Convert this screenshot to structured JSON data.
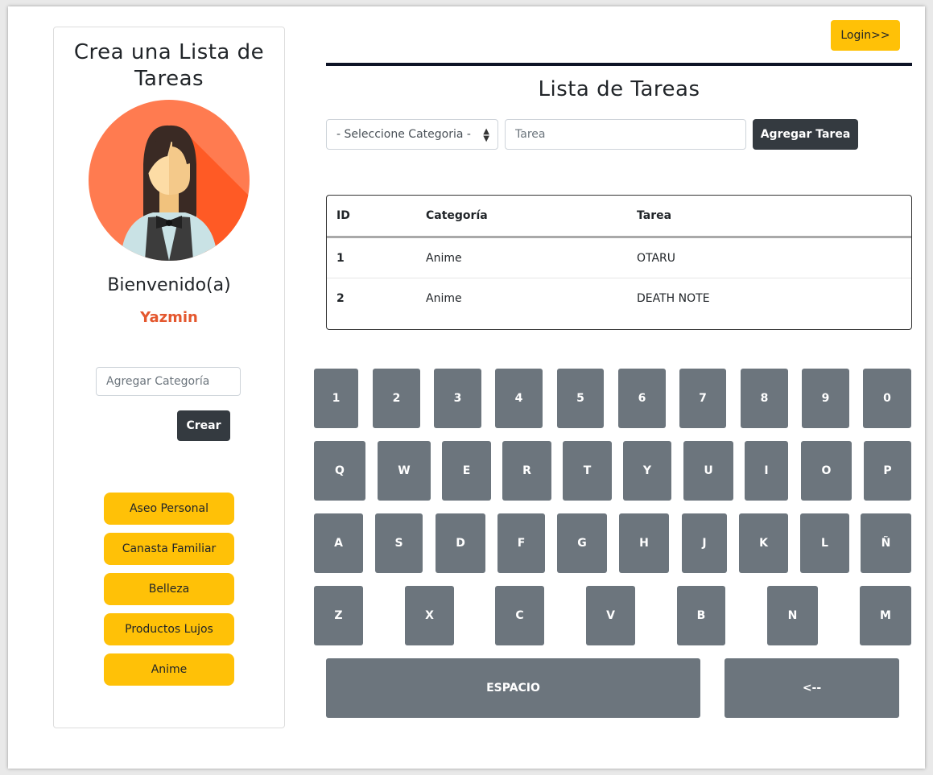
{
  "sidebar": {
    "title": "Crea una Lista de Tareas",
    "welcome": "Bienvenido(a)",
    "username": "Yazmin",
    "category_input_placeholder": "Agregar Categoría",
    "create_label": "Crear",
    "categories": [
      "Aseo Personal",
      "Canasta Familiar",
      "Belleza",
      "Productos Lujos",
      "Anime"
    ]
  },
  "header": {
    "login_label": "Login>>"
  },
  "main": {
    "title": "Lista de Tareas",
    "category_select_value": "- Seleccione Categoria -",
    "task_input_placeholder": "Tarea",
    "add_task_label": "Agregar Tarea",
    "table": {
      "headers": [
        "ID",
        "Categoría",
        "Tarea"
      ],
      "rows": [
        [
          "1",
          "Anime",
          "OTARU"
        ],
        [
          "2",
          "Anime",
          "DEATH NOTE"
        ]
      ]
    }
  },
  "keyboard": {
    "row1": [
      "1",
      "2",
      "3",
      "4",
      "5",
      "6",
      "7",
      "8",
      "9",
      "0"
    ],
    "row2": [
      "Q",
      "W",
      "E",
      "R",
      "T",
      "Y",
      "U",
      "I",
      "O",
      "P"
    ],
    "row3": [
      "A",
      "S",
      "D",
      "F",
      "G",
      "H",
      "J",
      "K",
      "L",
      "Ñ"
    ],
    "row4": [
      "Z",
      "X",
      "C",
      "V",
      "B",
      "N",
      "M"
    ],
    "space_label": "ESPACIO",
    "backspace_label": "<--"
  },
  "colors": {
    "accent_yellow": "#ffc107",
    "dark_button": "#343a40",
    "key_gray": "#6c757d",
    "username_orange": "#e4572e"
  }
}
